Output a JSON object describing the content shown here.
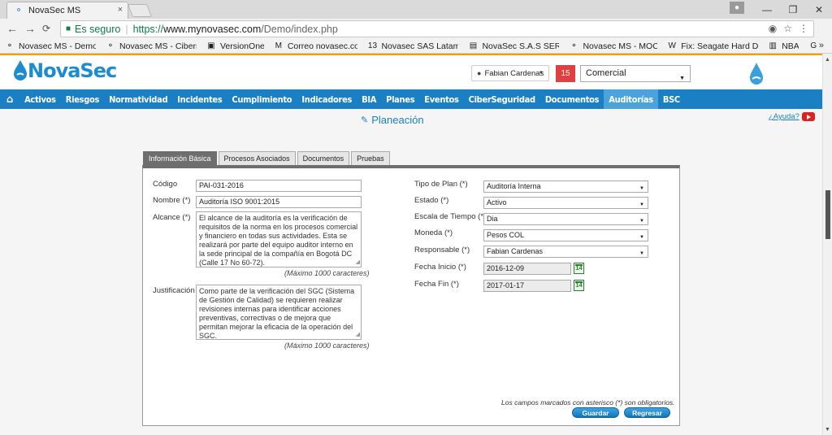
{
  "browser": {
    "tab_title": "NovaSec MS",
    "tab_close": "×",
    "window_buttons": [
      "—",
      "❐",
      "✕"
    ],
    "nav": {
      "back": "←",
      "forward": "→",
      "reload": "C"
    },
    "omnibox": {
      "secure_label": "Es seguro",
      "separator": "|",
      "url_protocol": "https://",
      "url_host": "www.mynovasec.com",
      "url_path": "/Demo/index.php"
    },
    "omni_icons": [
      "◉",
      "☆",
      "⋮"
    ],
    "bookmarks": [
      {
        "icon": "⚬",
        "label": "Novasec MS - Demo"
      },
      {
        "icon": "⚬",
        "label": "Novasec MS - Cibers"
      },
      {
        "icon": "▣",
        "label": "VersionOne"
      },
      {
        "icon": "M",
        "label": "Correo novasec.co"
      },
      {
        "icon": "13",
        "label": "Novasec SAS Latam -"
      },
      {
        "icon": "▤",
        "label": "NovaSec S.A.S SERVI"
      },
      {
        "icon": "⚬",
        "label": "Novasec MS - MOC"
      },
      {
        "icon": "W",
        "label": "Fix: Seagate Hard Dr"
      },
      {
        "icon": "▥",
        "label": "NBA"
      },
      {
        "icon": "G",
        "label": ""
      }
    ],
    "bookmarks_more": "»"
  },
  "header": {
    "logo_text": "NovaSec",
    "user_name": "Fabian Cardenas",
    "notifications": "15",
    "role": "Comercial"
  },
  "menu": [
    {
      "label": "Activos",
      "active": false
    },
    {
      "label": "Riesgos",
      "active": false
    },
    {
      "label": "Normatividad",
      "active": false
    },
    {
      "label": "Incidentes",
      "active": false
    },
    {
      "label": "Cumplimiento",
      "active": false
    },
    {
      "label": "Indicadores",
      "active": false
    },
    {
      "label": "BIA",
      "active": false
    },
    {
      "label": "Planes",
      "active": false
    },
    {
      "label": "Eventos",
      "active": false
    },
    {
      "label": "CiberSeguridad",
      "active": false
    },
    {
      "label": "Documentos",
      "active": false
    },
    {
      "label": "Auditorías",
      "active": true
    },
    {
      "label": "BSC",
      "active": false
    }
  ],
  "page": {
    "title": "Planeación",
    "help": "¿Ayuda?"
  },
  "form_tabs": [
    {
      "label": "Información Básica",
      "active": true
    },
    {
      "label": "Procesos Asociados",
      "active": false
    },
    {
      "label": "Documentos",
      "active": false
    },
    {
      "label": "Pruebas",
      "active": false
    }
  ],
  "form": {
    "codigo": {
      "label": "Código",
      "value": "PAI-031-2016"
    },
    "nombre": {
      "label": "Nombre (*)",
      "value": "Auditoría ISO 9001:2015"
    },
    "alcance": {
      "label": "Alcance (*)",
      "value": "El alcance de la auditoría es la verificación de requisitos de la norma en los procesos comercial y financiero en todas sus actividades. Esta se realizará por parte del equipo auditor interno en la sede principal de la compañía en Bogotá DC (Calle 17 No 60-72).",
      "hint": "(Máximo 1000 caracteres)"
    },
    "justificacion": {
      "label": "Justificación",
      "value": "Como parte de la verificación del SGC (Sistema de Gestión de Calidad) se requieren realizar revisiones internas para identificar acciones preventivas, correctivas o de mejora que permitan mejorar la eficacia de la operación del SGC.",
      "hint": "(Máximo 1000 caracteres)"
    },
    "tipo_plan": {
      "label": "Tipo de Plan (*)",
      "value": "Auditoría Interna"
    },
    "estado": {
      "label": "Estado (*)",
      "value": "Activo"
    },
    "escala": {
      "label": "Escala de Tiempo (*)",
      "value": "Dia"
    },
    "moneda": {
      "label": "Moneda (*)",
      "value": "Pesos COL"
    },
    "responsable": {
      "label": "Responsable (*)",
      "value": "Fabian Cardenas"
    },
    "fecha_inicio": {
      "label": "Fecha Inicio (*)",
      "value": "2016-12-09",
      "cal": "14"
    },
    "fecha_fin": {
      "label": "Fecha Fin (*)",
      "value": "2017-01-17",
      "cal": "14"
    },
    "required_note": "Los campos marcados con asterisco (*) son obligatorios.",
    "save_label": "Guardar",
    "back_label": "Regresar"
  },
  "colors": {
    "brand": "#1b80c3",
    "active_menu": "#4ba3dc",
    "accent_bar": "#f0a000",
    "notif": "#e04040"
  }
}
